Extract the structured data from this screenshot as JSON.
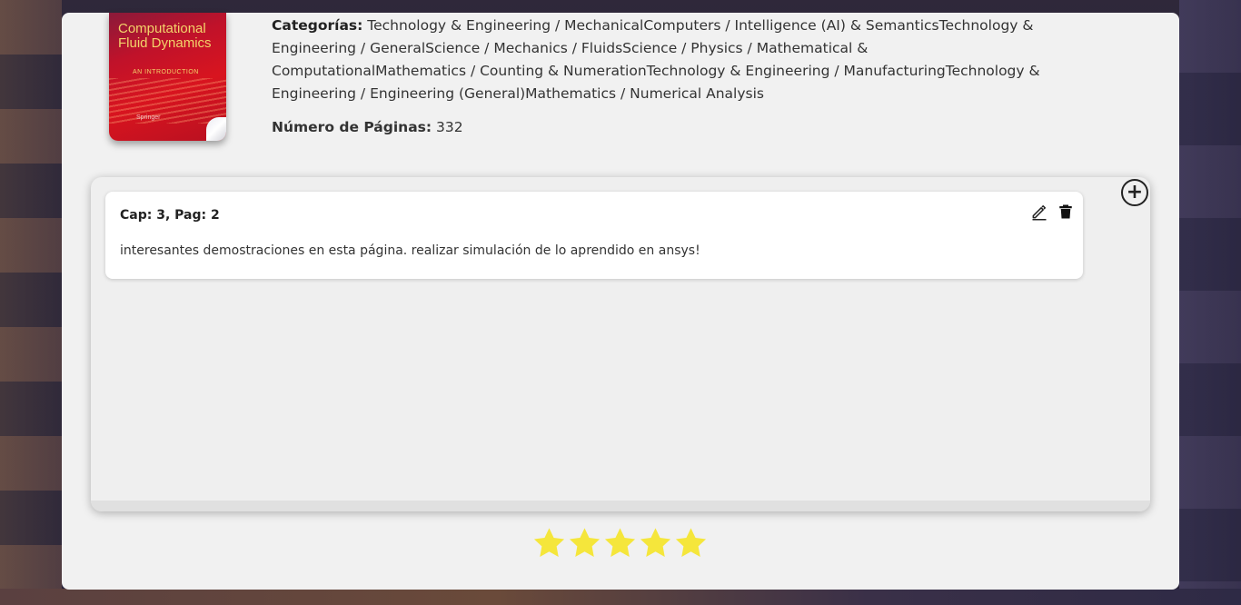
{
  "book": {
    "cover": {
      "title": "Computational Fluid Dynamics",
      "subtitle": "AN INTRODUCTION",
      "publisher": "Springer"
    },
    "categories_label": "Categorías:",
    "categories_value": "Technology & Engineering / MechanicalComputers / Intelligence (AI) & SemanticsTechnology & Engineering / GeneralScience / Mechanics / FluidsScience / Physics / Mathematical & ComputationalMathematics / Counting & NumerationTechnology & Engineering / ManufacturingTechnology & Engineering / Engineering (General)Mathematics / Numerical Analysis",
    "pages_label": "Número de Páginas:",
    "pages_value": "332"
  },
  "notes": [
    {
      "reference": "Cap: 3, Pag: 2",
      "text": "interesantes demostraciones en esta página. realizar simulación de lo aprendido en ansys!"
    }
  ],
  "rating": {
    "value": 5,
    "max": 5,
    "star_color": "#f5e63b"
  },
  "icons": {
    "add": "add-circle-icon",
    "edit": "pencil-icon",
    "delete": "trash-icon",
    "star": "star-icon"
  }
}
